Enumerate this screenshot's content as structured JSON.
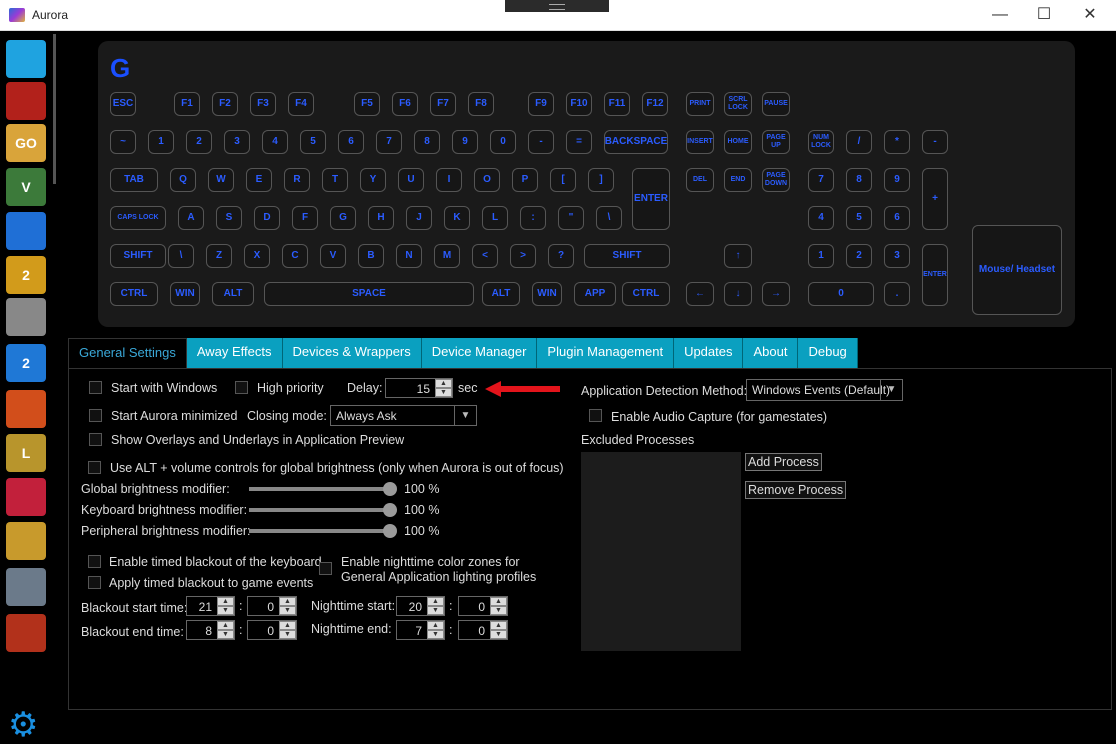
{
  "window": {
    "title": "Aurora",
    "controls": {
      "minimize": "—",
      "maximize": "☐",
      "close": "✕"
    }
  },
  "sidebar": {
    "items": [
      {
        "id": "desktop",
        "label": "",
        "color": "#1fa3e0"
      },
      {
        "id": "dota2",
        "label": "",
        "color": "#b2211b"
      },
      {
        "id": "csgo",
        "label": "GO",
        "color": "#d9a43a"
      },
      {
        "id": "gta5",
        "label": "V",
        "color": "#3c7a3a"
      },
      {
        "id": "rocket-league",
        "label": "",
        "color": "#1f6fd6"
      },
      {
        "id": "borderlands2",
        "label": "2",
        "color": "#d29b1b"
      },
      {
        "id": "overwatch",
        "label": "",
        "color": "#888888"
      },
      {
        "id": "payday2",
        "label": "2",
        "color": "#1f78d6"
      },
      {
        "id": "the-division",
        "label": "",
        "color": "#d24e1b"
      },
      {
        "id": "league-of-legends",
        "label": "L",
        "color": "#b8952c"
      },
      {
        "id": "hotline-miami",
        "label": "",
        "color": "#c2203b"
      },
      {
        "id": "deus-ex",
        "label": "",
        "color": "#c89a2c"
      },
      {
        "id": "pubg",
        "label": "",
        "color": "#6b7a8a"
      },
      {
        "id": "dying-light",
        "label": "",
        "color": "#b2311b"
      }
    ],
    "settings_icon": "gear-icon"
  },
  "keyboard": {
    "logo": "G",
    "accent": "#2b5cff",
    "mouse_headset_label": "Mouse/ Headset"
  },
  "tabs": [
    "General Settings",
    "Away Effects",
    "Devices & Wrappers",
    "Device Manager",
    "Plugin Management",
    "Updates",
    "About",
    "Debug"
  ],
  "general": {
    "start_with_windows": "Start with Windows",
    "high_priority": "High priority",
    "delay_label": "Delay:",
    "delay_value": "15",
    "delay_unit": "sec",
    "start_minimized": "Start Aurora minimized",
    "closing_mode_label": "Closing mode:",
    "closing_mode_value": "Always Ask",
    "show_overlays": "Show Overlays and Underlays in Application Preview",
    "alt_volume": "Use ALT + volume controls for global brightness (only when Aurora is out of focus)",
    "global_brightness_label": "Global brightness modifier:",
    "global_brightness_value": "100 %",
    "keyboard_brightness_label": "Keyboard brightness modifier:",
    "keyboard_brightness_value": "100 %",
    "peripheral_brightness_label": "Peripheral brightness modifier:",
    "peripheral_brightness_value": "100 %",
    "brightness_level": 1.0,
    "timed_blackout": "Enable timed blackout of the keyboard",
    "apply_timed_blackout": "Apply timed blackout to game events",
    "nighttime_zones_line1": "Enable nighttime color zones for",
    "nighttime_zones_line2": "General Application lighting profiles",
    "blackout_start_label": "Blackout start time:",
    "blackout_start_hour": "21",
    "blackout_start_minute": "0",
    "blackout_end_label": "Blackout end time:",
    "blackout_end_hour": "8",
    "blackout_end_minute": "0",
    "nighttime_start_label": "Nighttime start:",
    "nighttime_start_hour": "20",
    "nighttime_start_minute": "0",
    "nighttime_end_label": "Nighttime end:",
    "nighttime_end_hour": "7",
    "nighttime_end_minute": "0",
    "colon": ":",
    "detection_label": "Application Detection Method:",
    "detection_value": "Windows Events (Default)",
    "audio_capture": "Enable Audio Capture (for gamestates)",
    "excluded_label": "Excluded Processes",
    "add_process": "Add Process",
    "remove_process": "Remove Process"
  }
}
